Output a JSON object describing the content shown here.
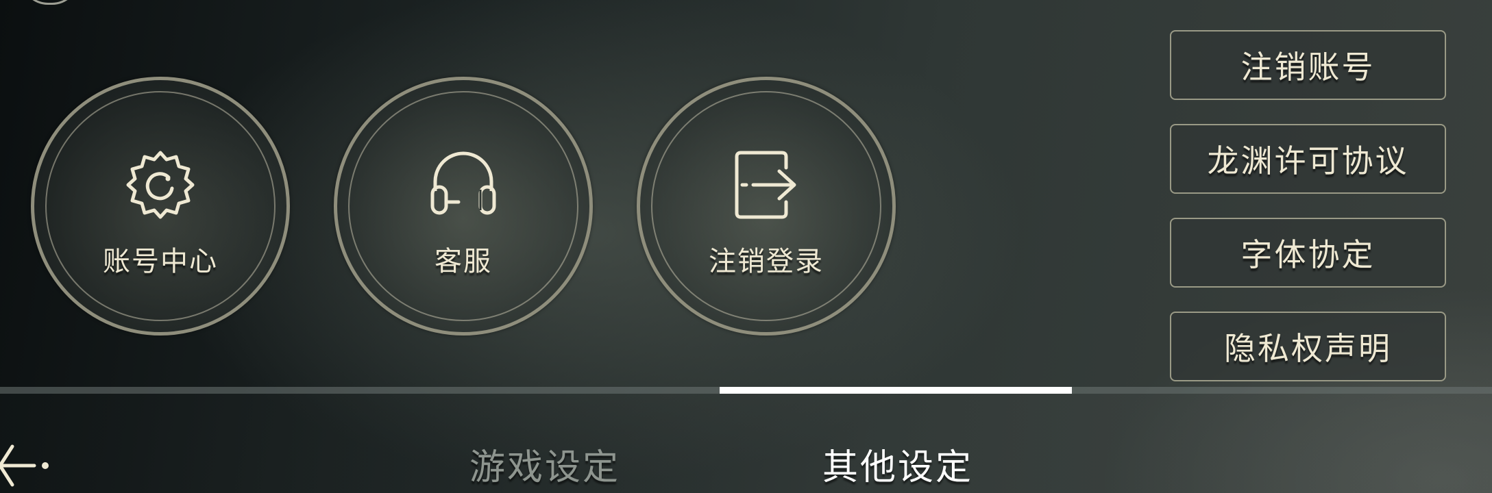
{
  "main_buttons": [
    {
      "label": "账号中心",
      "icon": "gear-icon"
    },
    {
      "label": "客服",
      "icon": "headset-icon"
    },
    {
      "label": "注销登录",
      "icon": "logout-icon"
    }
  ],
  "side_buttons": [
    {
      "label": "注销账号"
    },
    {
      "label": "龙渊许可协议"
    },
    {
      "label": "字体协定"
    },
    {
      "label": "隐私权声明"
    }
  ],
  "tabs": [
    {
      "label": "游戏设定",
      "active": false
    },
    {
      "label": "其他设定",
      "active": true
    }
  ],
  "back_icon": "back-arrow-icon",
  "colors": {
    "text_primary": "#efe9d3",
    "ring": "#8f8e7c",
    "tab_active": "#ffffff",
    "tab_inactive": "#8e958f"
  }
}
